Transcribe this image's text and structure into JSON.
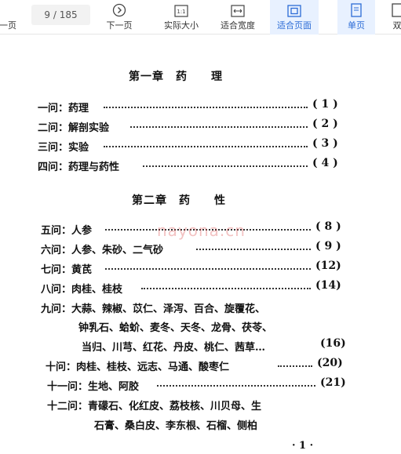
{
  "toolbar": {
    "prev_label": "一页",
    "page_current": "9",
    "page_total": "/ 185",
    "next_label": "下一页",
    "actual_size_label": "实际大小",
    "fit_width_label": "适合宽度",
    "fit_page_label": "适合页面",
    "single_page_label": "单页",
    "double_page_label": "双",
    "icon_actual_text": "1:1"
  },
  "document": {
    "chapter1_title": "第一章　药　　理",
    "chapter2_title": "第二章　药　　性",
    "entries": [
      {
        "q": "一问：",
        "t": "药理",
        "p": "( 1 )"
      },
      {
        "q": "二问：",
        "t": "解剖实验",
        "p": "( 2 )"
      },
      {
        "q": "三问：",
        "t": "实验",
        "p": "( 3 )"
      },
      {
        "q": "四问：",
        "t": "药理与药性",
        "p": "( 4 )"
      },
      {
        "q": "五问：",
        "t": "人参",
        "p": "( 8 )"
      },
      {
        "q": "六问：",
        "t": "人参、朱砂、二气砂",
        "p": "( 9 )"
      },
      {
        "q": "七问：",
        "t": "黄芪",
        "p": "(12)"
      },
      {
        "q": "八问：",
        "t": "肉桂、桂枝",
        "p": "(14)"
      },
      {
        "q": "九问：",
        "t": "大蒜、辣椒、苡仁、泽泻、百合、旋覆花、"
      },
      {
        "t": "钟乳石、蛤蚧、麦冬、天冬、龙骨、茯苓、"
      },
      {
        "t": "当归、川芎、红花、丹皮、桃仁、茜草…",
        "p": "(16)"
      },
      {
        "q": "十问：",
        "t": "肉桂、桂枝、远志、马通、酸枣仁",
        "p": "(20)"
      },
      {
        "q": "十一问：",
        "t": "生地、阿胶",
        "p": "(21)"
      },
      {
        "q": "十二问：",
        "t": "青礞石、化红皮、荔枝核、川贝母、生"
      },
      {
        "t": "石膏、桑白皮、李东根、石榴、侧柏"
      }
    ],
    "footer": "· 1 ·",
    "watermark": "nayona.cn"
  }
}
